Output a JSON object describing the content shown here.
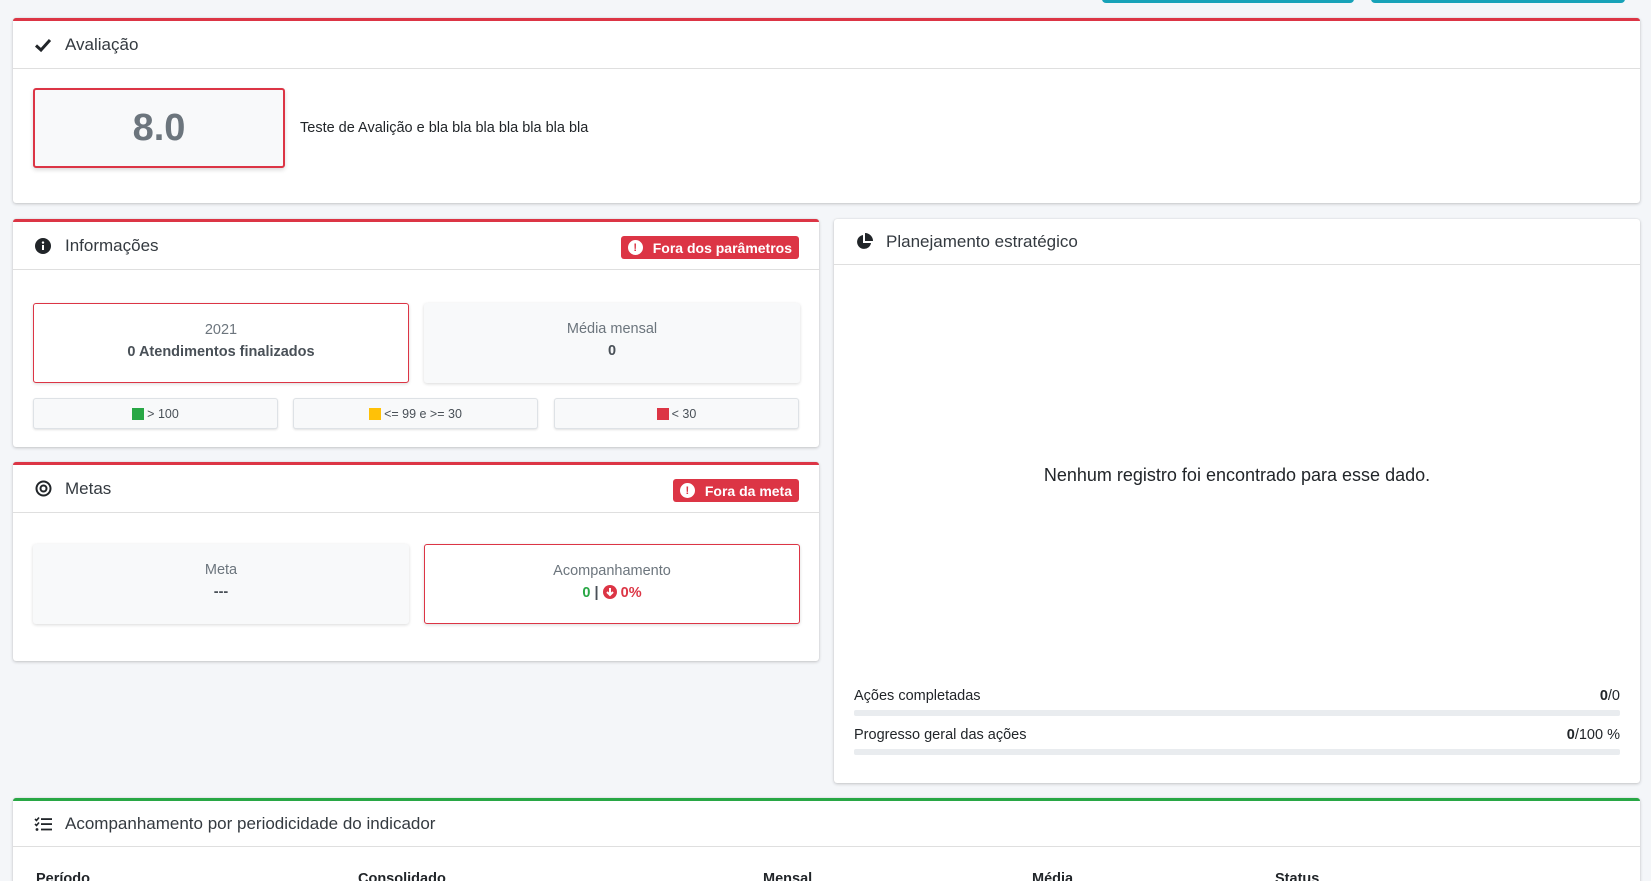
{
  "avaliacao": {
    "title": "Avaliação",
    "score": "8.0",
    "description": "Teste de Avalição e bla bla bla bla bla bla bla"
  },
  "informacoes": {
    "title": "Informações",
    "badge": "Fora dos parâmetros",
    "box_year": "2021",
    "box_year_value": "0 Atendimentos finalizados",
    "box_media_label": "Média mensal",
    "box_media_value": "0",
    "legend": [
      {
        "label": "> 100",
        "color": "#28a745"
      },
      {
        "label": "<= 99 e >= 30",
        "color": "#ffc107"
      },
      {
        "label": "< 30",
        "color": "#dc3545"
      }
    ]
  },
  "metas": {
    "title": "Metas",
    "badge": "Fora da meta",
    "meta_label": "Meta",
    "meta_value": "---",
    "acomp_label": "Acompanhamento",
    "acomp_value": "0",
    "acomp_sep": "|",
    "acomp_pct": "0%"
  },
  "planejamento": {
    "title": "Planejamento estratégico",
    "empty_message": "Nenhum registro foi encontrado para esse dado.",
    "acoes_label": "Ações completadas",
    "acoes_done": "0",
    "acoes_total": "/0",
    "acoes_fraction": 0,
    "progresso_label": "Progresso geral das ações",
    "progresso_done": "0",
    "progresso_total": "/100 %",
    "progresso_fraction": 0
  },
  "acompanhamento": {
    "title": "Acompanhamento por periodicidade do indicador",
    "columns": [
      "Período",
      "Consolidado",
      "Mensal",
      "Média",
      "Status"
    ]
  },
  "colors": {
    "danger": "#dc3545",
    "success": "#28a745",
    "warning": "#ffc107",
    "info": "#17a2b8"
  }
}
